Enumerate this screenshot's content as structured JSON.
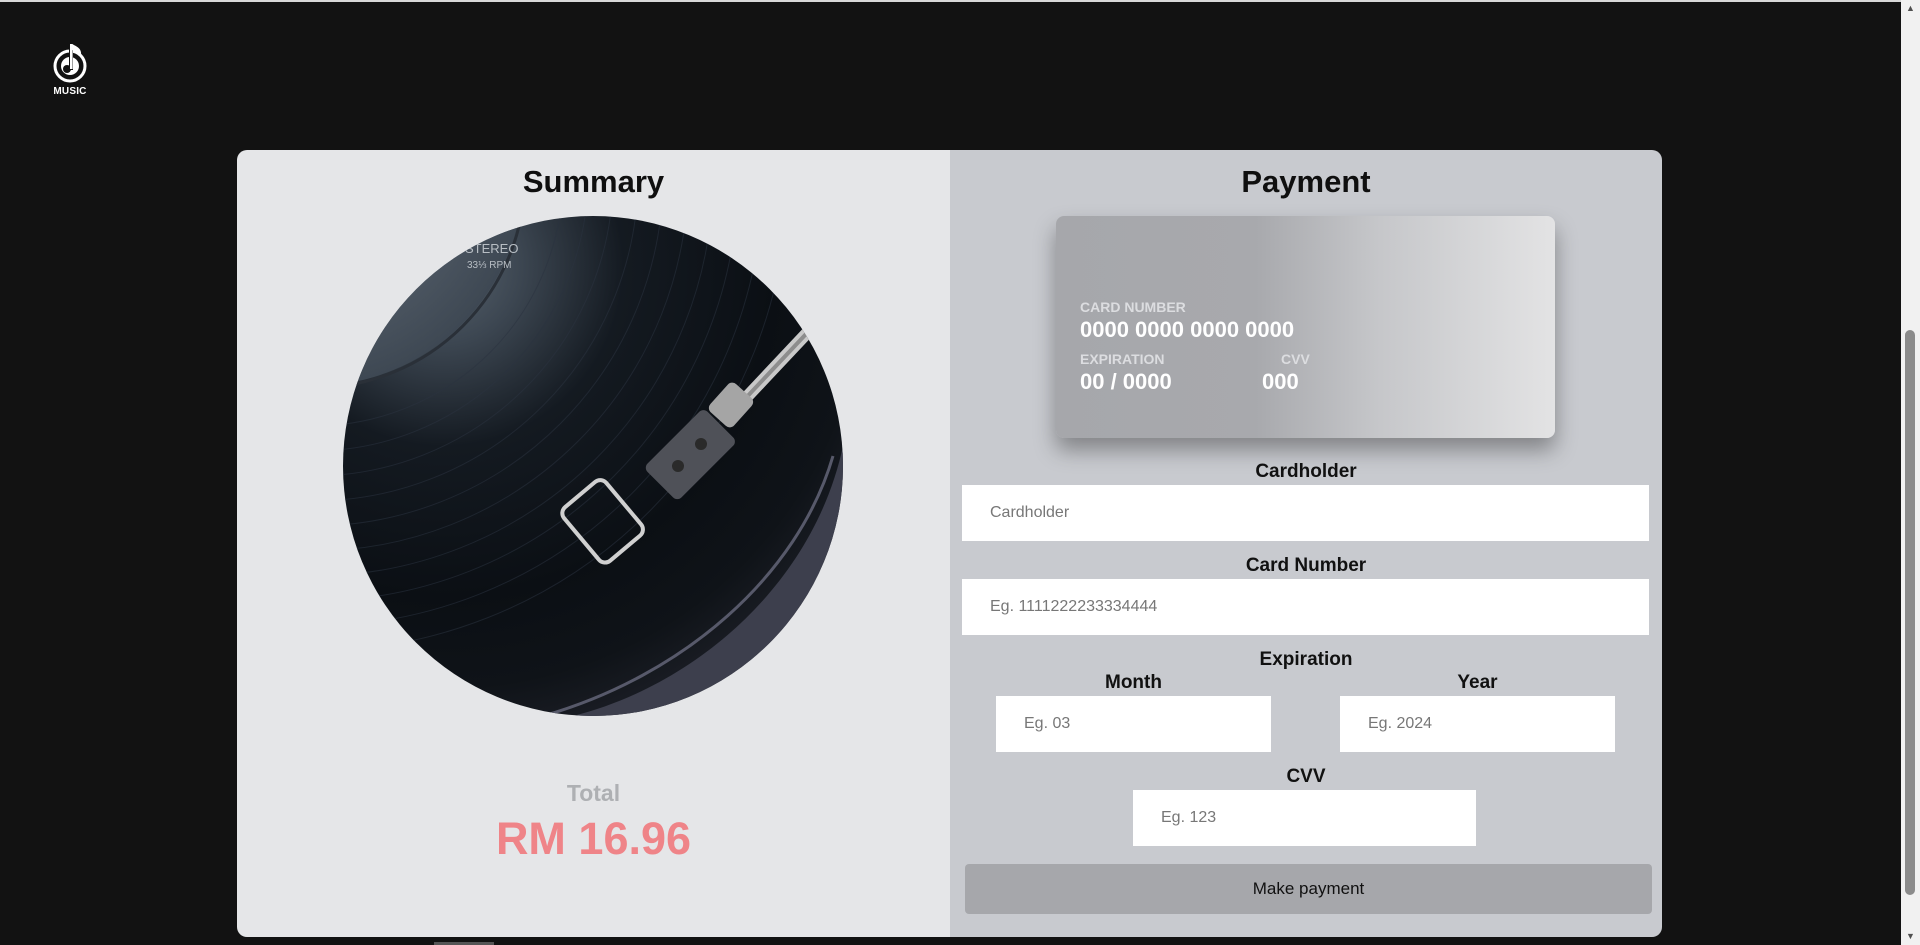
{
  "brand": {
    "logo_icon": "music-note-disc-icon",
    "logo_text": "MUSIC"
  },
  "summary": {
    "title": "Summary",
    "image": "vinyl-record-turntable",
    "image_text": {
      "line1": "STEREO",
      "line2": "33⅓ RPM"
    },
    "total_label": "Total",
    "total_value": "RM 16.96"
  },
  "payment": {
    "title": "Payment",
    "card_preview": {
      "number_label": "CARD NUMBER",
      "number_value": "0000 0000 0000 0000",
      "expiration_label": "EXPIRATION",
      "expiration_value": "00 / 0000",
      "cvv_label": "CVV",
      "cvv_value": "000"
    },
    "cardholder": {
      "label": "Cardholder",
      "placeholder": "Cardholder",
      "value": ""
    },
    "card_number": {
      "label": "Card Number",
      "placeholder": "Eg. 1111222233334444",
      "value": ""
    },
    "expiration": {
      "label": "Expiration",
      "month_label": "Month",
      "month_placeholder": "Eg. 03",
      "year_label": "Year",
      "year_placeholder": "Eg. 2024"
    },
    "cvv": {
      "label": "CVV",
      "placeholder": "Eg. 123",
      "value": ""
    },
    "submit_label": "Make payment"
  },
  "colors": {
    "page_background": "#121212",
    "summary_background": "#e5e6e8",
    "payment_background": "#c8cacf",
    "total_value": "#ef8488",
    "button": "#a6a7ab"
  }
}
